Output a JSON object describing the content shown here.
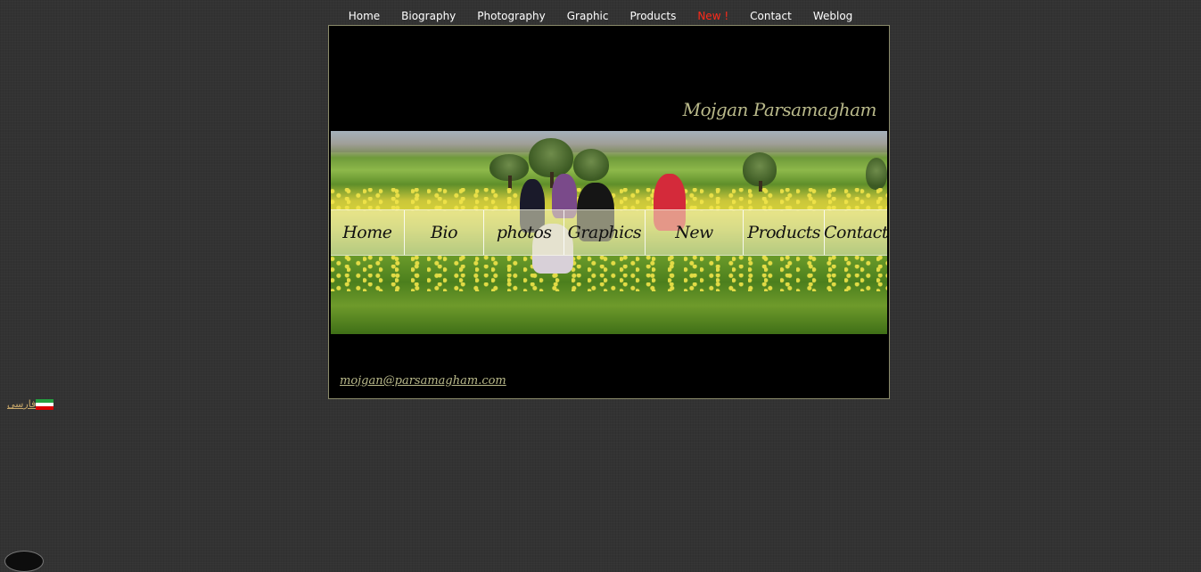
{
  "top_nav": {
    "items": [
      {
        "label": "Home"
      },
      {
        "label": "Biography"
      },
      {
        "label": "Photography"
      },
      {
        "label": "Graphic"
      },
      {
        "label": "Products"
      },
      {
        "label": "New !",
        "color": "#ff2a1a"
      },
      {
        "label": "Contact"
      },
      {
        "label": "Weblog"
      }
    ]
  },
  "header": {
    "site_name": "Mojgan Parsamagham"
  },
  "banner_nav": {
    "items": [
      {
        "label": "Home"
      },
      {
        "label": "Bio"
      },
      {
        "label": "photos"
      },
      {
        "label": "Graphics"
      },
      {
        "label": "New"
      },
      {
        "label": "Products"
      },
      {
        "label": "Contact"
      }
    ]
  },
  "footer": {
    "email": "mojgan@parsamagham.com"
  },
  "language": {
    "label": "فارسی",
    "flag_icon": "iran-flag-icon"
  },
  "colors": {
    "background": "#333333",
    "accent_text": "#b9b98a",
    "new_link": "#ff2a1a"
  }
}
